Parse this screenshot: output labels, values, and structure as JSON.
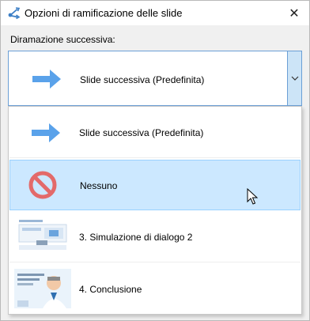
{
  "window": {
    "title": "Opzioni di ramificazione delle slide",
    "close_glyph": "✕"
  },
  "branch": {
    "label": "Diramazione successiva:",
    "selected_value": "Slide successiva (Predefinita)"
  },
  "options": [
    {
      "label": "Slide successiva (Predefinita)",
      "icon": "next-arrow-icon",
      "selected": false
    },
    {
      "label": "Nessuno",
      "icon": "no-entry-icon",
      "selected": true
    },
    {
      "label": "3. Simulazione di dialogo 2",
      "icon": "slide-thumbnail",
      "selected": false
    },
    {
      "label": "4. Conclusione",
      "icon": "slide-thumbnail",
      "selected": false
    }
  ],
  "colors": {
    "accent": "#4f9be8",
    "selected_bg": "#cce8ff",
    "no_entry": "#e36a6a"
  }
}
